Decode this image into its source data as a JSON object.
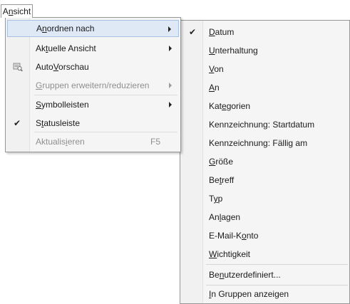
{
  "menubar": {
    "label": "Ansicht"
  },
  "menu": {
    "arrange": {
      "label": "Anordnen nach"
    },
    "current_view": {
      "label": "Aktuelle Ansicht"
    },
    "autopreview": {
      "label": "AutoVorschau"
    },
    "groups": {
      "label": "Gruppen erweitern/reduzieren"
    },
    "toolbars": {
      "label": "Symbolleisten"
    },
    "statusbar": {
      "label": "Statusleiste"
    },
    "refresh": {
      "label": "Aktualisieren",
      "shortcut": "F5"
    }
  },
  "submenu": {
    "datum": "Datum",
    "unterhaltung": "Unterhaltung",
    "von": "Von",
    "an": "An",
    "kategorien": "Kategorien",
    "start": "Kennzeichnung: Startdatum",
    "faellig": "Kennzeichnung: Fällig am",
    "groesse": "Größe",
    "betreff": "Betreff",
    "typ": "Typ",
    "anlagen": "Anlagen",
    "konto": "E-Mail-Konto",
    "wichtigkeit": "Wichtigkeit",
    "custom": "Benutzerdefiniert...",
    "groups_show": "In Gruppen anzeigen"
  },
  "colors": {
    "highlight": "#dfe8f5",
    "highlight_border": "#a9c0e0",
    "disabled": "#8f8f8f"
  }
}
